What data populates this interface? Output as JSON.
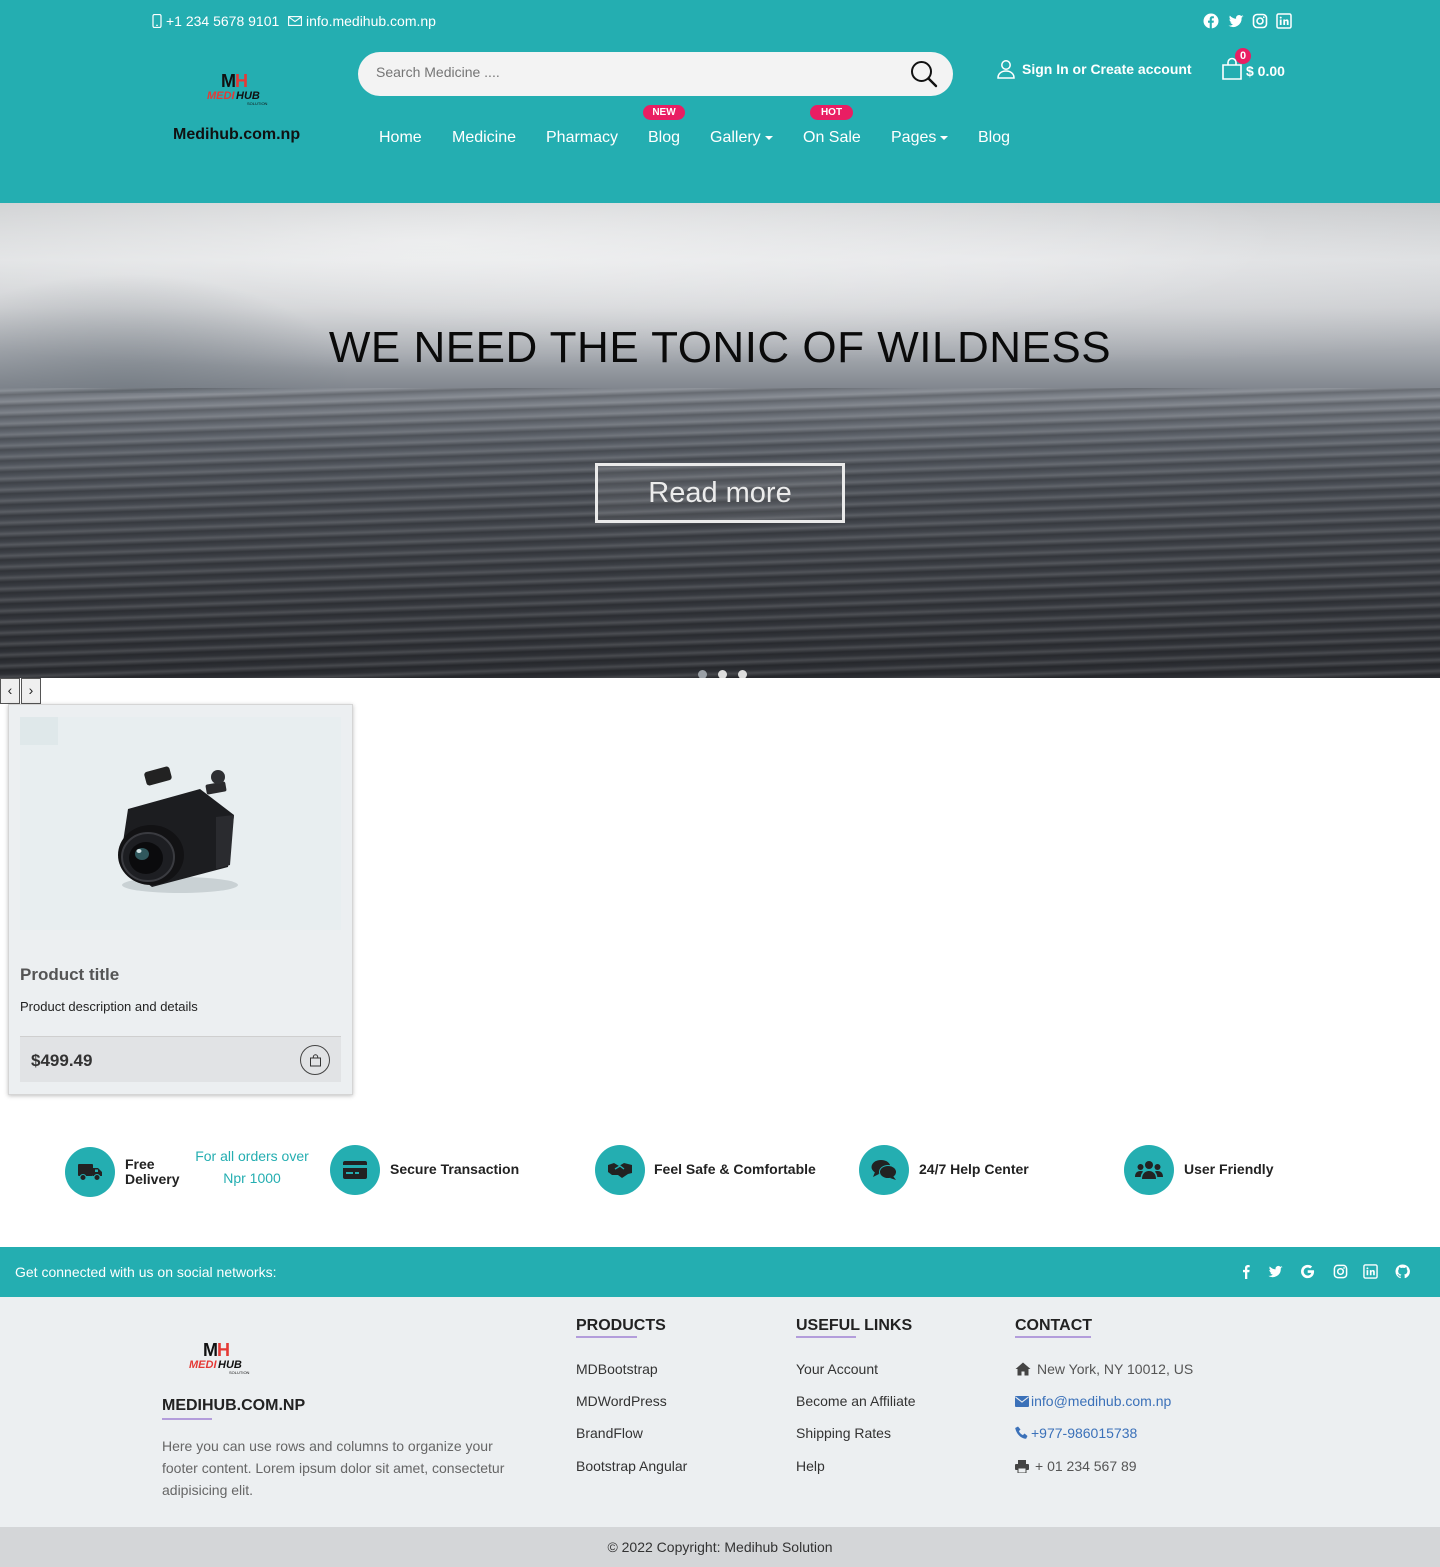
{
  "topbar": {
    "phone": "+1 234 5678 9101",
    "email": "info.medihub.com.np",
    "social_icons": [
      "facebook-icon",
      "twitter-icon",
      "instagram-icon",
      "linkedin-icon"
    ]
  },
  "brand": {
    "logo_text_top": "MH",
    "logo_text_mid": "MEDIHUB",
    "logo_text_bottom": "SOLUTION",
    "name": "Medihub.com.np"
  },
  "search": {
    "placeholder": "Search Medicine ...."
  },
  "account": {
    "signin_label": "Sign In or Create account"
  },
  "cart": {
    "count": "0",
    "total": "$ 0.00"
  },
  "nav": {
    "items": [
      {
        "label": "Home"
      },
      {
        "label": "Medicine"
      },
      {
        "label": "Pharmacy"
      },
      {
        "label": "Blog",
        "badge": "NEW"
      },
      {
        "label": "Gallery",
        "dropdown": true
      },
      {
        "label": "On Sale",
        "badge": "HOT"
      },
      {
        "label": "Pages",
        "dropdown": true
      },
      {
        "label": "Blog"
      }
    ]
  },
  "hero": {
    "title": "WE NEED THE TONIC OF WILDNESS",
    "button": "Read more",
    "slides": 3,
    "active_slide": 1
  },
  "carousel": {
    "prev": "‹",
    "next": "›"
  },
  "product": {
    "title": "Product title",
    "description": "Product description and details",
    "price": "$499.49"
  },
  "features": [
    {
      "label": "Free Delivery",
      "label_line1": "Free",
      "label_line2": "Delivery",
      "note": "For all orders over Npr 1000",
      "icon": "truck-icon"
    },
    {
      "label": "Secure Transaction",
      "icon": "credit-card-icon"
    },
    {
      "label": "Feel Safe & Comfortable",
      "icon": "handshake-icon"
    },
    {
      "label": "24/7 Help Center",
      "icon": "comments-icon"
    },
    {
      "label": "User Friendly",
      "icon": "users-icon"
    }
  ],
  "social_bar": {
    "text": "Get connected with us on social networks:",
    "icons": [
      "facebook-icon",
      "twitter-icon",
      "google-icon",
      "instagram-icon",
      "linkedin-icon",
      "github-icon"
    ]
  },
  "footer": {
    "brand": "MEDIHUB.COM.NP",
    "text": "Here you can use rows and columns to organize your footer content. Lorem ipsum dolor sit amet, consectetur adipisicing elit.",
    "products_heading": "PRODUCTS",
    "products": [
      "MDBootstrap",
      "MDWordPress",
      "BrandFlow",
      "Bootstrap Angular"
    ],
    "links_heading": "USEFUL LINKS",
    "links": [
      "Your Account",
      "Become an Affiliate",
      "Shipping Rates",
      "Help"
    ],
    "contact_heading": "CONTACT",
    "address": "New York, NY 10012, US",
    "email": "info@medihub.com.np",
    "phone": "+977-986015738",
    "fax": "+ 01 234 567 89"
  },
  "copyright": "© 2022 Copyright: Medihub Solution",
  "colors": {
    "primary": "#24aeb1",
    "badge": "#e91e63",
    "link": "#3b71b9"
  }
}
